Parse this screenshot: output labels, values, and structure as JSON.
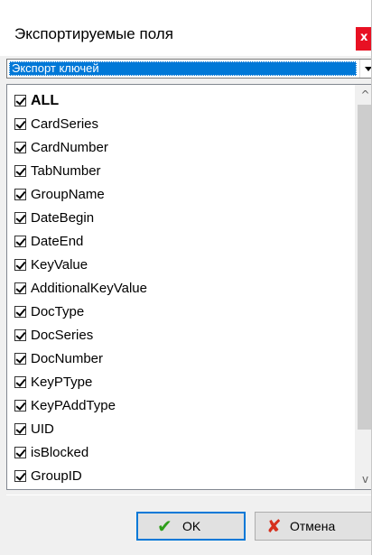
{
  "window": {
    "title": "Экспортируемые поля",
    "close_label": "x"
  },
  "combo": {
    "selected": "Экспорт ключей"
  },
  "scrollbar": {
    "up_arrow": "^",
    "down_arrow": "v",
    "position": 0.0
  },
  "fields": [
    {
      "label": "ALL",
      "checked": true,
      "bold": true
    },
    {
      "label": "CardSeries",
      "checked": true
    },
    {
      "label": "CardNumber",
      "checked": true
    },
    {
      "label": "TabNumber",
      "checked": true
    },
    {
      "label": "GroupName",
      "checked": true
    },
    {
      "label": "DateBegin",
      "checked": true
    },
    {
      "label": "DateEnd",
      "checked": true
    },
    {
      "label": "KeyValue",
      "checked": true
    },
    {
      "label": "AdditionalKeyValue",
      "checked": true
    },
    {
      "label": "DocType",
      "checked": true
    },
    {
      "label": "DocSeries",
      "checked": true
    },
    {
      "label": "DocNumber",
      "checked": true
    },
    {
      "label": "KeyPType",
      "checked": true
    },
    {
      "label": "KeyPAddType",
      "checked": true
    },
    {
      "label": "UID",
      "checked": true
    },
    {
      "label": "isBlocked",
      "checked": true
    },
    {
      "label": "GroupID",
      "checked": true
    }
  ],
  "buttons": {
    "ok_icon": "✔",
    "ok_label": "OK",
    "cancel_icon": "✘",
    "cancel_label": "Отмена"
  },
  "colors": {
    "selection": "#0078d7",
    "close": "#e81123",
    "ok_icon": "#2e9e1b",
    "cancel_icon": "#d6301d"
  }
}
